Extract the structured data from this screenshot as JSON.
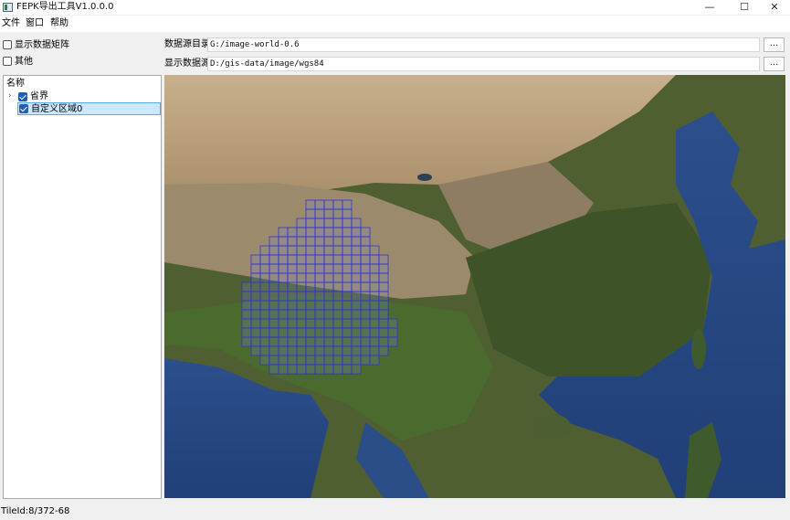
{
  "window": {
    "title": "FEPK导出工具V1.0.0.0",
    "minimize_glyph": "—",
    "maximize_glyph": "☐",
    "close_glyph": "✕"
  },
  "menu": [
    "文件",
    "窗口",
    "帮助"
  ],
  "options": {
    "show_matrix_label": "显示数据矩阵",
    "show_matrix_checked": false,
    "other_label": "其他",
    "other_checked": false
  },
  "data_source": {
    "dir_label": "数据源目录",
    "dir_value": "G:/image-world-0.6",
    "display_label": "显示数据源",
    "display_value": "D:/gis-data/image/wgs84",
    "browse_label": "..."
  },
  "tree": {
    "header": "名称",
    "items": [
      {
        "label": "省界",
        "checked": true,
        "expandable": true
      },
      {
        "label": "自定义区域0",
        "checked": true,
        "selected": true
      }
    ]
  },
  "status": {
    "text": "TileId:8/372-68"
  },
  "colors": {
    "grid_line": "#2b2bd6",
    "selection_bg": "#cce8ff",
    "selection_border": "#5da9e6"
  }
}
